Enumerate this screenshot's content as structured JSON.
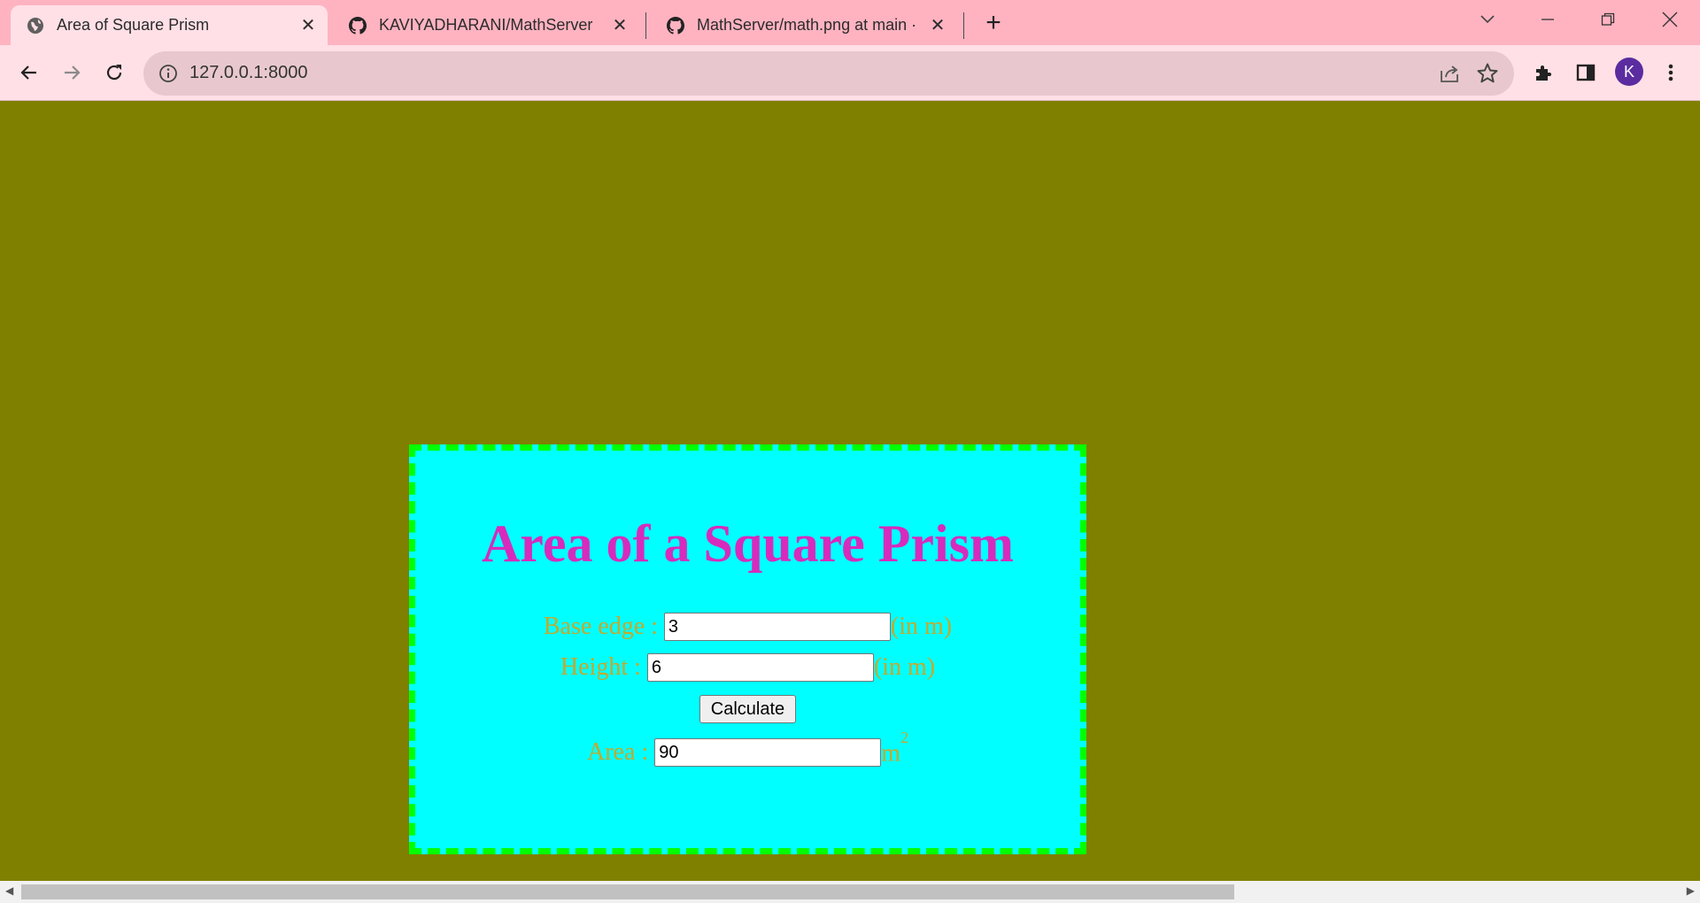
{
  "browser": {
    "tabs": [
      {
        "title": "Area of Square Prism",
        "icon": "globe-icon",
        "active": true
      },
      {
        "title": "KAVIYADHARANI/MathServer",
        "icon": "github-icon",
        "active": false
      },
      {
        "title": "MathServer/math.png at main · ",
        "icon": "github-icon",
        "active": false
      }
    ],
    "url": "127.0.0.1:8000",
    "profile_initial": "K"
  },
  "page": {
    "heading": "Area of a Square Prism",
    "base_edge_label": "Base edge :",
    "base_edge_value": "3",
    "base_edge_unit": "(in m)",
    "height_label": "Height :",
    "height_value": "6",
    "height_unit": "(in m)",
    "calculate_label": "Calculate",
    "area_label": "Area :",
    "area_value": "90",
    "area_unit": "m",
    "area_unit_exp": "2"
  },
  "colors": {
    "page_bg": "#808000",
    "card_bg": "#00ffff",
    "card_border": "#00ff00",
    "heading": "#d72bbd",
    "label": "#c4a92c"
  }
}
